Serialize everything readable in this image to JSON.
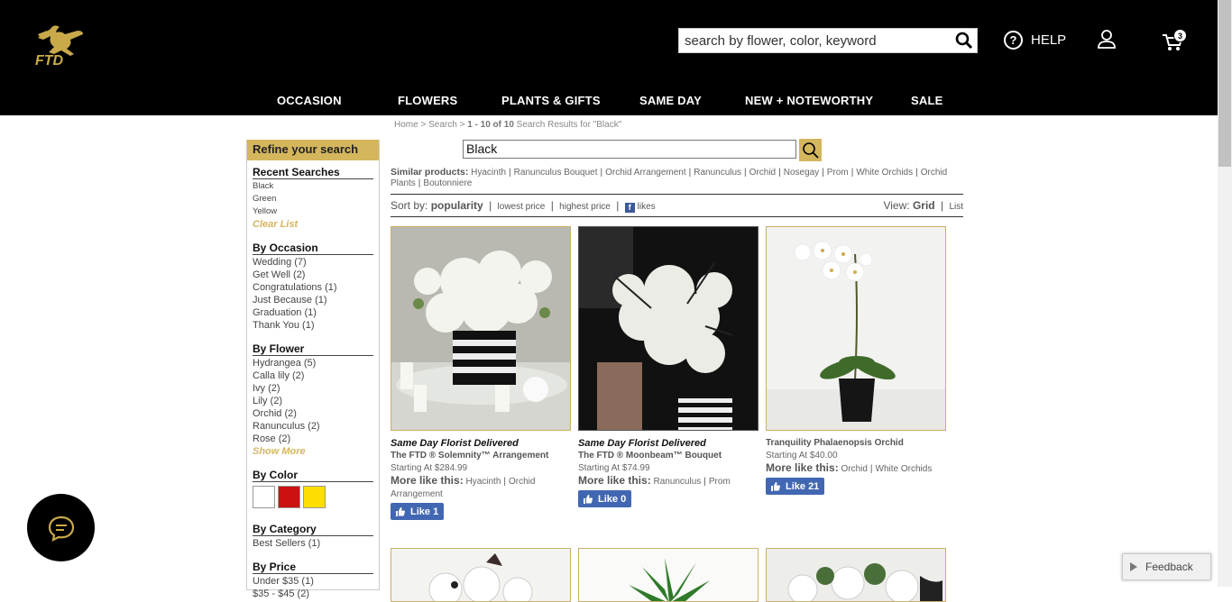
{
  "header": {
    "search_placeholder": "search by flower, color, keyword",
    "help_label": "HELP",
    "help_icon_glyph": "?",
    "cart_count": "3",
    "brand_text": "FTD",
    "nav": [
      "OCCASION",
      "FLOWERS",
      "PLANTS & GIFTS",
      "SAME DAY",
      "NEW + NOTEWORTHY",
      "SALE"
    ]
  },
  "breadcrumb": {
    "home": "Home",
    "sep": ">",
    "search": "Search",
    "results": "1 - 10 of 10",
    "results_suffix": "Search Results for \"Black\""
  },
  "sidebar": {
    "title": "Refine your search",
    "recent_title": "Recent Searches",
    "recent": [
      "Black",
      "Green",
      "Yellow"
    ],
    "clear_list": "Clear List",
    "occasion_title": "By Occasion",
    "occasions": [
      "Wedding (7)",
      "Get Well (2)",
      "Congratulations (1)",
      "Just Because (1)",
      "Graduation (1)",
      "Thank You (1)"
    ],
    "flower_title": "By Flower",
    "flowers": [
      "Hydrangea (5)",
      "Calla lily (2)",
      "Ivy (2)",
      "Lily (2)",
      "Orchid (2)",
      "Ranunculus (2)",
      "Rose (2)"
    ],
    "show_more": "Show More",
    "color_title": "By Color",
    "colors": [
      "#ffffff",
      "#cc1111",
      "#ffdd00"
    ],
    "category_title": "By Category",
    "categories": [
      "Best Sellers (1)"
    ],
    "price_title": "By Price",
    "prices": [
      "Under $35 (1)",
      "$35 - $45 (2)"
    ]
  },
  "search": {
    "query": "Black"
  },
  "similar": {
    "label": "Similar products:",
    "items": [
      "Hyacinth",
      "Ranunculus Bouquet",
      "Orchid Arrangement",
      "Ranunculus",
      "Orchid",
      "Nosegay",
      "Prom",
      "White Orchids",
      "Orchid Plants",
      "Boutonniere"
    ],
    "sep": "|"
  },
  "sort": {
    "label": "Sort by:",
    "active": "popularity",
    "options": [
      "lowest price",
      "highest price"
    ],
    "likes": "likes",
    "fb_glyph": "f",
    "view_label": "View:",
    "view_active": "Grid",
    "view_other": "List"
  },
  "products": [
    {
      "badge": "Same Day Florist Delivered",
      "name": "The FTD ® Solemnity™ Arrangement",
      "price": "Starting At $284.99",
      "more_label": "More like this:",
      "more": [
        "Hyacinth",
        "Orchid Arrangement"
      ],
      "like": "Like 1"
    },
    {
      "badge": "Same Day Florist Delivered",
      "name": "The FTD ® Moonbeam™ Bouquet",
      "price": "Starting At $74.99",
      "more_label": "More like this:",
      "more": [
        "Ranunculus",
        "Prom"
      ],
      "like": "Like 0"
    },
    {
      "badge": "",
      "name": "Tranquility Phalaenopsis Orchid",
      "price": "Starting At $40.00",
      "more_label": "More like this:",
      "more": [
        "Orchid",
        "White Orchids"
      ],
      "like": "Like 21"
    }
  ],
  "feedback": "Feedback",
  "colors": {
    "gold": "#d4b65d",
    "facebook": "#4267b2",
    "header_bg": "#000000"
  }
}
